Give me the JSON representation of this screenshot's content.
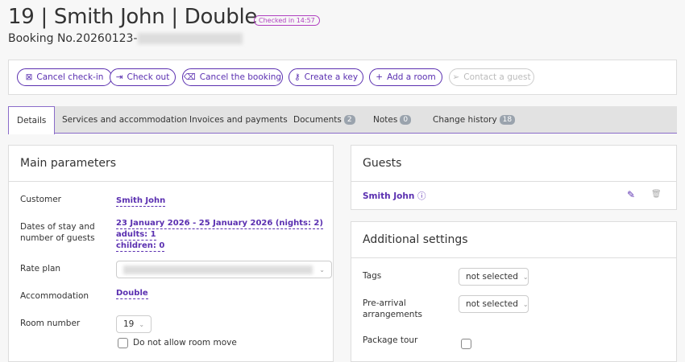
{
  "header": {
    "title": "19 | Smith John | Double",
    "status_badge": "Checked in 14:57",
    "booking_prefix": "Booking No.20260123-"
  },
  "actions": [
    {
      "label": "Cancel check-in",
      "icon": "cancel-checkin-icon",
      "glyph": "⊠"
    },
    {
      "label": "Check out",
      "icon": "check-out-icon",
      "glyph": "⇥"
    },
    {
      "label": "Cancel the booking",
      "icon": "backspace-icon",
      "glyph": "⌫"
    },
    {
      "label": "Create a key",
      "icon": "key-icon",
      "glyph": "⚷"
    },
    {
      "label": "Add a room",
      "icon": "plus-icon",
      "glyph": "+"
    },
    {
      "label": "Contact a guest",
      "icon": "send-icon",
      "glyph": "➢"
    }
  ],
  "tabs": [
    {
      "label": "Details"
    },
    {
      "label": "Services and accommodation"
    },
    {
      "label": "Invoices and payments"
    },
    {
      "label": "Documents",
      "count": "2"
    },
    {
      "label": "Notes",
      "count": "0"
    },
    {
      "label": "Change history",
      "count": "18"
    }
  ],
  "main": {
    "title": "Main parameters",
    "customer_label": "Customer",
    "customer": "Smith John",
    "dates_label": "Dates of stay and number of guests",
    "dates": "23 January 2026 - 25 January 2026 (nights: 2)",
    "adults": "adults: 1",
    "children": "children: 0",
    "rate_label": "Rate plan",
    "accommodation_label": "Accommodation",
    "accommodation": "Double",
    "room_label": "Room number",
    "room": "19",
    "no_move_label": "Do not allow room move"
  },
  "guests": {
    "title": "Guests",
    "name": "Smith John"
  },
  "additional": {
    "title": "Additional settings",
    "tags_label": "Tags",
    "tags_value": "not selected",
    "prearrival_label": "Pre-arrival arrangements",
    "prearrival_value": "not selected",
    "package_label": "Package tour"
  },
  "colors": {
    "accent": "#5a2fb0",
    "badge": "#b040c0"
  }
}
